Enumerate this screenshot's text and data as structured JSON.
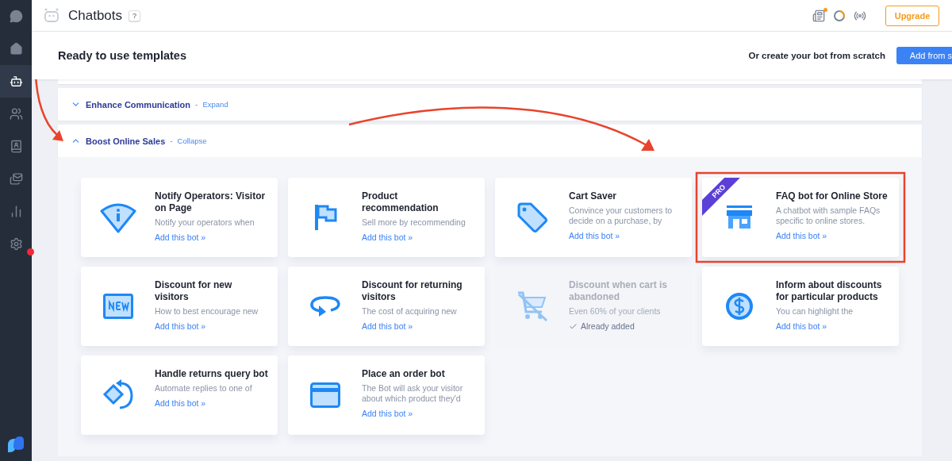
{
  "sidebar": {
    "items": [
      {
        "selected": false,
        "alert": false
      },
      {
        "selected": false,
        "alert": false
      },
      {
        "selected": true,
        "alert": false
      },
      {
        "selected": false,
        "alert": false
      },
      {
        "selected": false,
        "alert": false
      },
      {
        "selected": false,
        "alert": false
      },
      {
        "selected": false,
        "alert": false
      },
      {
        "selected": false,
        "alert": true
      }
    ]
  },
  "topbar": {
    "title": "Chatbots",
    "help": "?",
    "news_unread": true,
    "upgrade": "Upgrade"
  },
  "header": {
    "title": "Ready to use templates",
    "scratch_label": "Or create your bot from scratch",
    "add_button": "Add from s"
  },
  "sections": [
    {
      "title": "Enhance Communication",
      "separator": "-",
      "toggle": "Expand",
      "expanded": false
    },
    {
      "title": "Boost Online Sales",
      "separator": "-",
      "toggle": "Collapse",
      "expanded": true
    }
  ],
  "cards": [
    {
      "title": "Notify Operators: Visitor on Page",
      "description": "Notify your operators when",
      "link": "Add this bot »",
      "added": false,
      "pro": false
    },
    {
      "title": "Product recommendation",
      "description": "Sell more by recommending",
      "link": "Add this bot »",
      "added": false,
      "pro": false
    },
    {
      "title": "Cart Saver",
      "description": "Convince your customers to decide on a purchase, by",
      "link": "Add this bot »",
      "added": false,
      "pro": false
    },
    {
      "title": "FAQ bot for Online Store",
      "description": "A chatbot with sample FAQs specific to online stores.",
      "link": "Add this bot »",
      "added": false,
      "pro": true,
      "badge": "PRO"
    },
    {
      "title": "Discount for new visitors",
      "description": "How to best encourage new",
      "link": "Add this bot »",
      "added": false,
      "pro": false
    },
    {
      "title": "Discount for returning visitors",
      "description": "The cost of acquiring new",
      "link": "Add this bot »",
      "added": false,
      "pro": false
    },
    {
      "title": "Discount when cart is abandoned",
      "description": "Even 60% of your clients",
      "status": "Already added",
      "added": true,
      "pro": false
    },
    {
      "title": "Inform about discounts for particular products",
      "description": "You can highlight the",
      "link": "Add this bot »",
      "added": false,
      "pro": false
    },
    {
      "title": "Handle returns query bot",
      "description": "Automate replies to one of",
      "link": "Add this bot »",
      "added": false,
      "pro": false
    },
    {
      "title": "Place an order bot",
      "description": "The Bot will ask your visitor about which product they'd",
      "link": "Add this bot »",
      "added": false,
      "pro": false
    }
  ]
}
